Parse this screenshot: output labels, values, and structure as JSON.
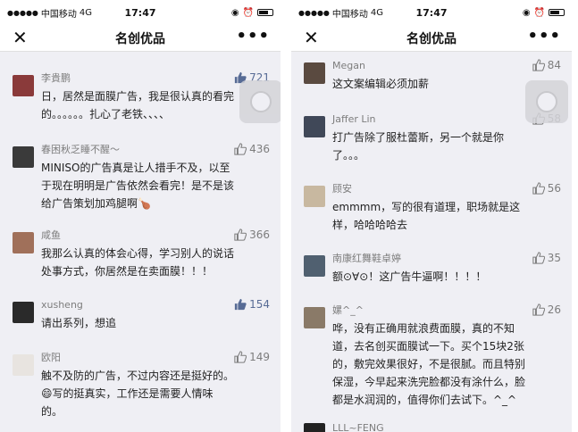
{
  "status": {
    "carrier": "中国移动",
    "network": "4G",
    "time": "17:47",
    "signal": "●●●●●"
  },
  "nav": {
    "title": "名创优品",
    "close_icon": "close-icon",
    "more_icon": "more-icon"
  },
  "left": {
    "comments": [
      {
        "name": "李貴鹏",
        "likes": "721",
        "liked": true,
        "text": "日，居然是面膜广告，我是很认真的看完\n的。。。。。。扎心了老铁、、、、",
        "avatar_color": "#8a3a3a"
      },
      {
        "name": "春困秋乏睡不醒～",
        "likes": "436",
        "liked": false,
        "text": "MINISO的广告真是让人措手不及，以至\n于现在明明是广告依然会看完！是不是该\n给广告策划加鸡腿啊🍗",
        "avatar_color": "#3a3a3a"
      },
      {
        "name": "咸鱼",
        "likes": "366",
        "liked": false,
        "text": "我那么认真的体会心得，学习别人的说话\n处事方式，你居然是在卖面膜！！！",
        "avatar_color": "#a0705a"
      },
      {
        "name": "xusheng",
        "likes": "154",
        "liked": true,
        "text": "请出系列，想追",
        "avatar_color": "#2a2a2a"
      },
      {
        "name": "欧阳",
        "likes": "149",
        "liked": false,
        "text": "触不及防的广告，不过内容还是挺好的。\n😄写的挺真实，工作还是需要人情味\n的。",
        "avatar_color": "#e8e4e0"
      }
    ]
  },
  "right": {
    "comments": [
      {
        "name": "Megan",
        "likes": "84",
        "liked": false,
        "text": "这文案编辑必须加薪",
        "avatar_color": "#5a4a40"
      },
      {
        "name": "Jaffer Lin",
        "likes": "58",
        "liked": false,
        "text": "打广告除了服杜蕾斯，另一个就是你\n了。。。",
        "avatar_color": "#404858"
      },
      {
        "name": "顾安",
        "likes": "56",
        "liked": false,
        "text": "emmmm，写的很有道理，职场就是这\n样，哈哈哈哈去",
        "avatar_color": "#c8b8a0"
      },
      {
        "name": "南康红舞鞋卓婷",
        "likes": "35",
        "liked": false,
        "text": "额⊙∀⊙！这广告牛逼啊！！！！",
        "avatar_color": "#506070"
      },
      {
        "name": "嫘^_^",
        "likes": "26",
        "liked": false,
        "text": "哗，没有正确用就浪费面膜，真的不知\n道，去名创买面膜试一下。买个15块2张\n的，敷完效果很好，不是很腻。而且特别\n保湿，今早起来洗完脸都没有涂什么，脸\n都是水润润的，值得你们去试下。^_^",
        "avatar_color": "#8a7a68"
      },
      {
        "name": "LLL~FENG",
        "likes": "",
        "liked": false,
        "text": "",
        "avatar_color": "#222222"
      }
    ]
  }
}
